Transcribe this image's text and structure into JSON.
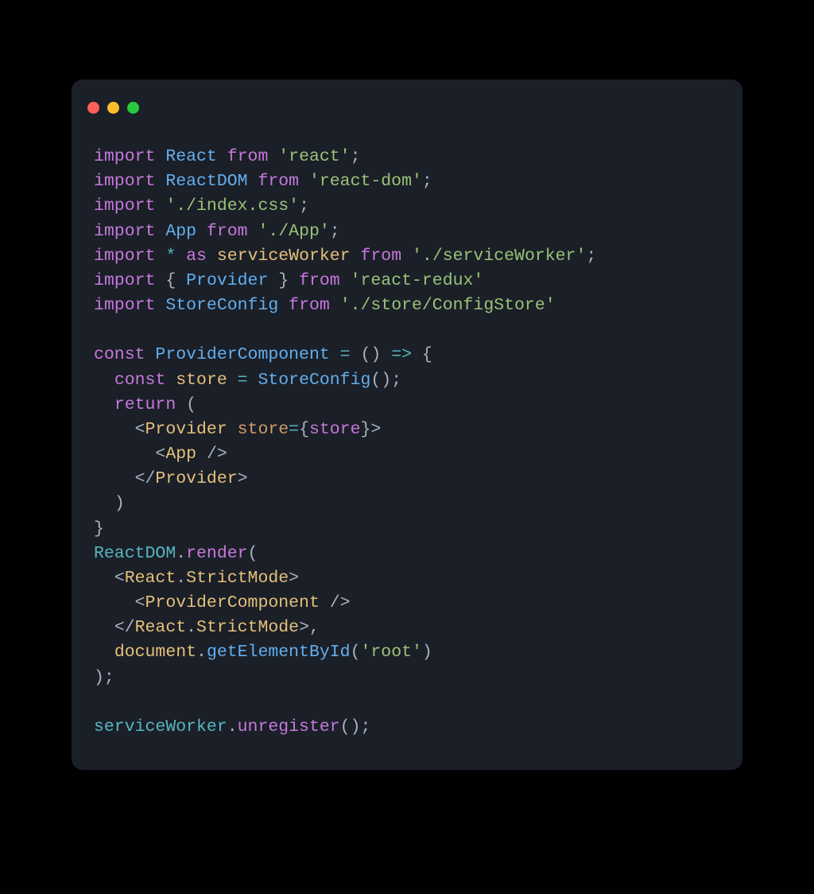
{
  "colors": {
    "bg": "#000000",
    "window": "#1b1f27",
    "close": "#ff5f56",
    "minimize": "#ffbd2e",
    "zoom": "#27c93f"
  },
  "code": {
    "l1": {
      "import": "import",
      "name": "React",
      "from": "from",
      "mod": "'react'",
      "semi": ";"
    },
    "l2": {
      "import": "import",
      "name": "ReactDOM",
      "from": "from",
      "mod": "'react-dom'",
      "semi": ";"
    },
    "l3": {
      "import": "import",
      "mod": "'./index.css'",
      "semi": ";"
    },
    "l4": {
      "import": "import",
      "name": "App",
      "from": "from",
      "mod": "'./App'",
      "semi": ";"
    },
    "l5": {
      "import": "import",
      "star": "*",
      "as": "as",
      "name": "serviceWorker",
      "from": "from",
      "mod": "'./serviceWorker'",
      "semi": ";"
    },
    "l6": {
      "import": "import",
      "lbrace": "{",
      "name": "Provider",
      "rbrace": "}",
      "from": "from",
      "mod": "'react-redux'"
    },
    "l7": {
      "import": "import",
      "name": "StoreConfig",
      "from": "from",
      "mod": "'./store/ConfigStore'"
    },
    "l9": {
      "const": "const",
      "name": "ProviderComponent",
      "eq": "=",
      "arrowArgs": "()",
      "arrow": "=>",
      "lbrace": "{"
    },
    "l10": {
      "const": "const",
      "name": "store",
      "eq": "=",
      "call": "StoreConfig",
      "parens": "()",
      "semi": ";"
    },
    "l11": {
      "return": "return",
      "open": "("
    },
    "l12": {
      "open": "<",
      "tag": "Provider",
      "attr": "store",
      "eq": "=",
      "lbr": "{",
      "val": "store",
      "rbr": "}",
      "close": ">"
    },
    "l13": {
      "open": "<",
      "tag": "App",
      "selfclose": "/>"
    },
    "l14": {
      "open": "</",
      "tag": "Provider",
      "close": ">"
    },
    "l15": {
      "close": ")"
    },
    "l16": {
      "brace": "}"
    },
    "l17": {
      "obj": "ReactDOM",
      "dot": ".",
      "fn": "render",
      "open": "("
    },
    "l18": {
      "open": "<",
      "tag1": "React",
      "dot": ".",
      "tag2": "StrictMode",
      "close": ">"
    },
    "l19": {
      "open": "<",
      "tag": "ProviderComponent",
      "selfclose": "/>"
    },
    "l20": {
      "open": "</",
      "tag1": "React",
      "dot": ".",
      "tag2": "StrictMode",
      "close": ">",
      "comma": ","
    },
    "l21": {
      "obj": "document",
      "dot": ".",
      "fn": "getElementById",
      "open": "(",
      "arg": "'root'",
      "close": ")"
    },
    "l22": {
      "close": ")",
      "semi": ";"
    },
    "l24": {
      "obj": "serviceWorker",
      "dot": ".",
      "fn": "unregister",
      "parens": "()",
      "semi": ";"
    }
  }
}
